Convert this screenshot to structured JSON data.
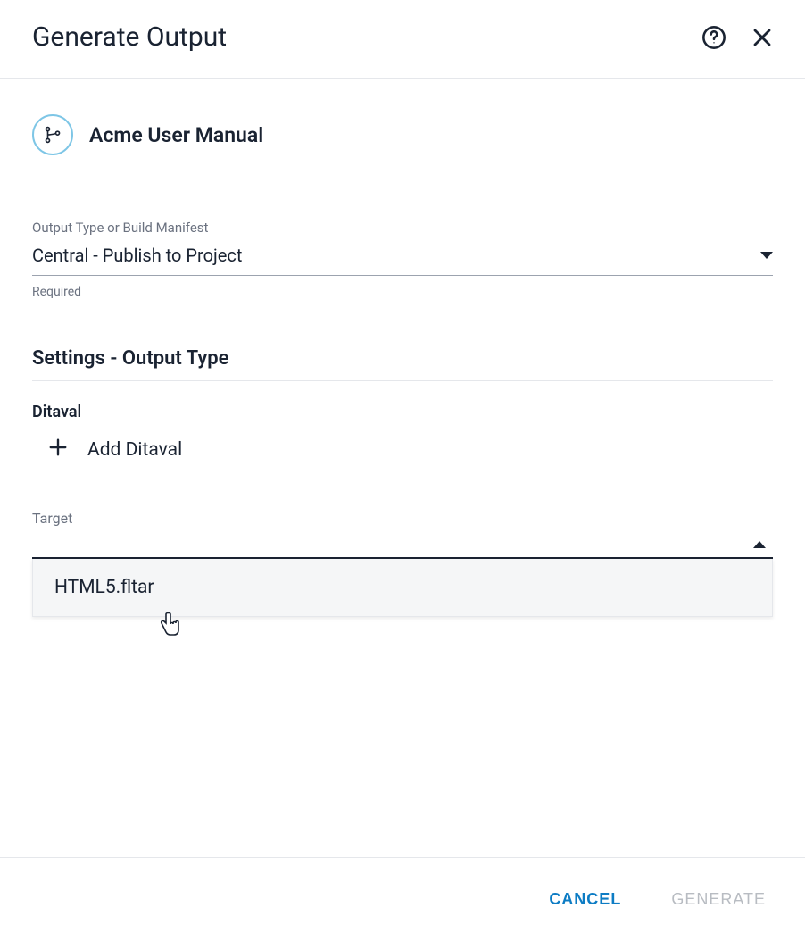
{
  "header": {
    "title": "Generate Output"
  },
  "project": {
    "name": "Acme User Manual"
  },
  "output_type": {
    "label": "Output Type or Build Manifest",
    "selected": "Central - Publish to Project",
    "helper": "Required"
  },
  "settings_heading": "Settings - Output Type",
  "ditaval": {
    "label": "Ditaval",
    "add_label": "Add Ditaval"
  },
  "target": {
    "label": "Target",
    "selected": "",
    "options": [
      "HTML5.fltar"
    ]
  },
  "footer": {
    "cancel": "CANCEL",
    "generate": "GENERATE"
  }
}
